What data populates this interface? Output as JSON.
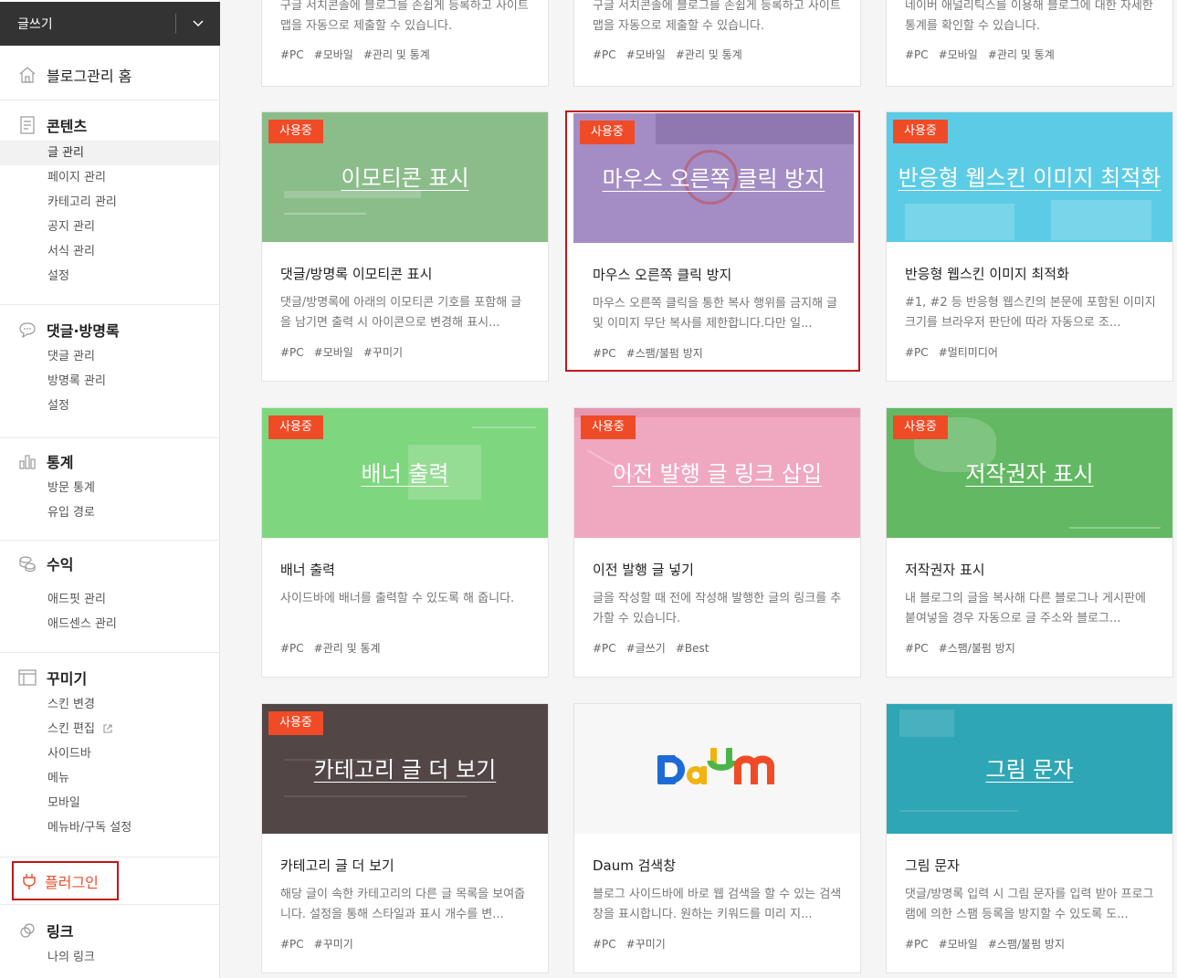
{
  "sidebar": {
    "write_label": "글쓰기",
    "home_label": "블로그관리 홈",
    "content": {
      "title": "콘텐츠",
      "items": [
        "글 관리",
        "페이지 관리",
        "카테고리 관리",
        "공지 관리",
        "서식 관리",
        "설정"
      ]
    },
    "comments": {
      "title": "댓글·방명록",
      "items": [
        "댓글 관리",
        "방명록 관리",
        "설정"
      ]
    },
    "stats": {
      "title": "통계",
      "items": [
        "방문 통계",
        "유입 경로"
      ]
    },
    "revenue": {
      "title": "수익",
      "items": [
        "애드핏 관리",
        "애드센스 관리"
      ]
    },
    "decorate": {
      "title": "꾸미기",
      "items": [
        "스킨 변경",
        "스킨 편집",
        "사이드바",
        "메뉴",
        "모바일",
        "메뉴바/구독 설정"
      ]
    },
    "plugin_label": "플러그인",
    "link": {
      "title": "링크",
      "items": [
        "나의 링크"
      ]
    }
  },
  "top_cards": [
    {
      "desc": "구글 서치콘솔에 블로그를 손쉽게 등록하고 사이트맵을 자동으로 제출할 수 있습니다.",
      "tags": [
        "#PC",
        "#모바일",
        "#관리 및 통계"
      ]
    },
    {
      "desc": "구글 서치콘솔에 블로그를 손쉽게 등록하고 사이트맵을 자동으로 제출할 수 있습니다.",
      "tags": [
        "#PC",
        "#모바일",
        "#관리 및 통계"
      ]
    },
    {
      "desc": "네이버 애널리틱스를 이용해 블로그에 대한 자세한 통계를 확인할 수 있습니다.",
      "tags": [
        "#PC",
        "#모바일",
        "#관리 및 통계"
      ]
    }
  ],
  "badge_label": "사용중",
  "cards": [
    {
      "thumb_title": "이모티콘 표시",
      "color": "#8bbd8b",
      "title": "댓글/방명록 이모티콘 표시",
      "desc": "댓글/방명록에 아래의 이모티콘 기호를 포함해 글을 남기면 출력 시 아이콘으로 변경해 표시...",
      "tags": [
        "#PC",
        "#모바일",
        "#꾸미기"
      ]
    },
    {
      "thumb_title": "마우스 오른쪽 클릭 방지",
      "color": "#a48dc4",
      "title": "마우스 오른쪽 클릭 방지",
      "desc": "마우스 오른쪽 클릭을 통한 복사 행위를 금지해 글 및 이미지 무단 복사를 제한합니다.다만 일...",
      "tags": [
        "#PC",
        "#스팸/불펌 방지"
      ]
    },
    {
      "thumb_title": "반응형 웹스킨 이미지 최적화",
      "color": "#5ccce6",
      "title": "반응형 웹스킨 이미지 최적화",
      "desc": "#1, #2 등 반응형 웹스킨의 본문에 포함된 이미지 크기를 브라우저 판단에 따라 자동으로 조...",
      "tags": [
        "#PC",
        "#멀티미디어"
      ]
    },
    {
      "thumb_title": "배너 출력",
      "color": "#7ed67e",
      "title": "배너 출력",
      "desc": "사이드바에 배너를 출력할 수 있도록 해 줍니다.",
      "tags": [
        "#PC",
        "#관리 및 통계"
      ]
    },
    {
      "thumb_title": "이전 발행 글 링크 삽입",
      "color": "#f0a8c0",
      "title": "이전 발행 글 넣기",
      "desc": "글을 작성할 때 전에 작성해 발행한 글의 링크를 추가할 수 있습니다.",
      "tags": [
        "#PC",
        "#글쓰기",
        "#Best"
      ]
    },
    {
      "thumb_title": "저작권자 표시",
      "color": "#63b863",
      "title": "저작권자 표시",
      "desc": "내 블로그의 글을 복사해 다른 블로그나 게시판에 붙여넣을 경우 자동으로 글 주소와 블로그...",
      "tags": [
        "#PC",
        "#스팸/불펌 방지"
      ]
    },
    {
      "thumb_title": "카테고리 글 더 보기",
      "color": "#524646",
      "title": "카테고리 글 더 보기",
      "desc": "해당 글이 속한 카테고리의 다른 글 목록을 보여줍니다. 설정을 통해 스타일과 표시 개수를 변...",
      "tags": [
        "#PC",
        "#꾸미기"
      ]
    },
    {
      "thumb_title": "",
      "logo_text": "Daum",
      "color": "#f7f7f7",
      "title": "Daum 검색창",
      "desc": "블로그 사이드바에 바로 웹 검색을 할 수 있는 검색창을 표시합니다. 원하는 키워드를 미리 지...",
      "tags": [
        "#PC",
        "#꾸미기"
      ]
    },
    {
      "thumb_title": "그림 문자",
      "color": "#2fa6b5",
      "title": "그림 문자",
      "desc": "댓글/방명록 입력 시 그림 문자를 입력 받아 프로그램에 의한 스팸 등록을 방지할 수 있도록 도...",
      "tags": [
        "#PC",
        "#모바일",
        "#스팸/불펌 방지"
      ]
    }
  ]
}
